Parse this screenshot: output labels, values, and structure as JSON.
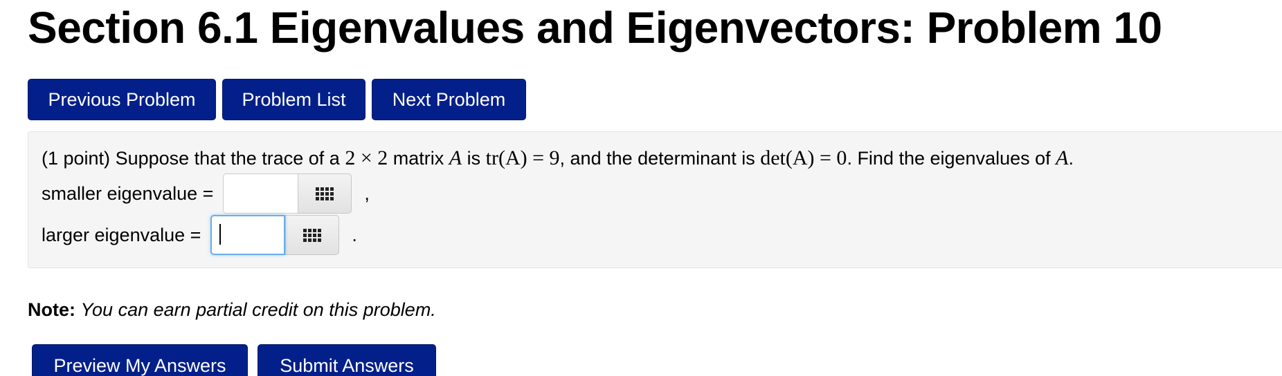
{
  "header": {
    "title": "Section 6.1 Eigenvalues and Eigenvectors: Problem 10"
  },
  "nav": {
    "previous_label": "Previous Problem",
    "list_label": "Problem List",
    "next_label": "Next Problem"
  },
  "problem": {
    "points": "(1 point)",
    "text_1": "Suppose that the trace of a",
    "math_size": "2 × 2",
    "text_2": "matrix",
    "math_A": "A",
    "text_3": "is",
    "math_trace": "tr(A) = 9",
    "text_4": ", and the determinant is",
    "math_det": "det(A) = 0",
    "text_5": ". Find the eigenvalues of",
    "math_A2": "A",
    "text_6": ".",
    "answers": [
      {
        "label": "smaller eigenvalue =",
        "value": "",
        "punctuation": ","
      },
      {
        "label": "larger eigenvalue =",
        "value": "",
        "punctuation": "."
      }
    ]
  },
  "note": {
    "bold": "Note:",
    "text": "You can earn partial credit on this problem."
  },
  "actions": {
    "preview_label": "Preview My Answers",
    "submit_label": "Submit Answers"
  },
  "icons": {
    "palette": "equation-palette-grid-icon"
  },
  "colors": {
    "button_bg": "#03208a",
    "panel_bg": "#f5f5f5",
    "focus_border": "#6aaee8"
  }
}
